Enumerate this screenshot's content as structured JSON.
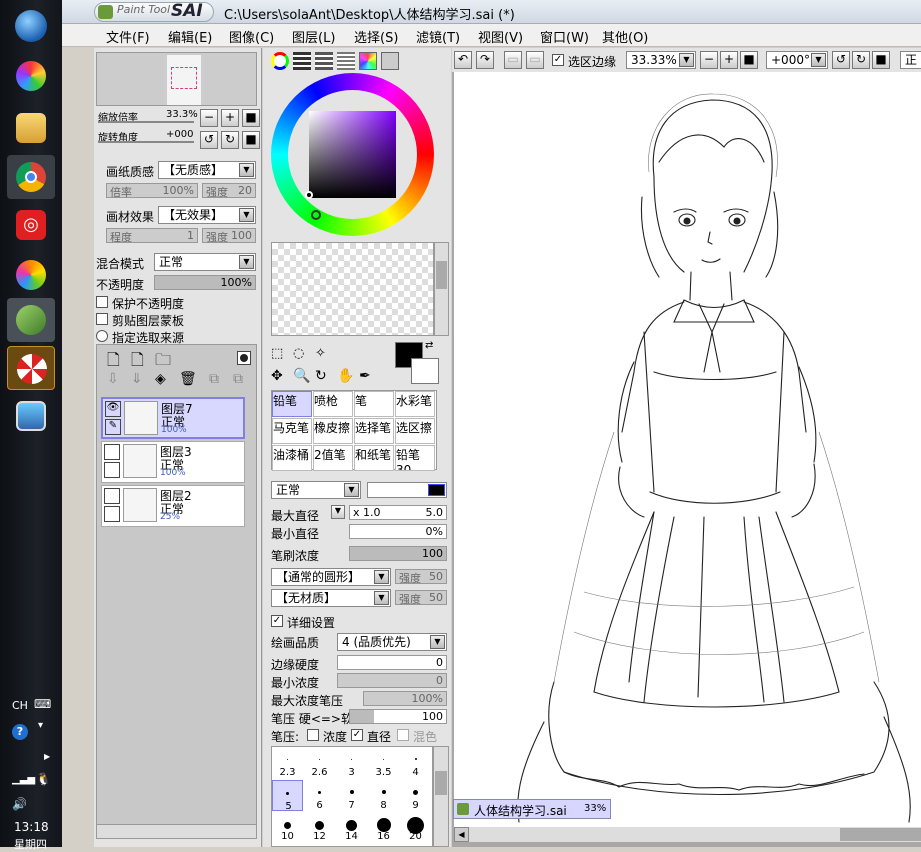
{
  "taskbar": {
    "apps": [
      "start-orb",
      "app-colorful",
      "file-explorer",
      "chrome",
      "netease-music",
      "app-ball",
      "paint-tool-sai",
      "app-umbrella",
      "app-picture"
    ],
    "tray": {
      "lang": "CH",
      "time": "13:18",
      "day": "星期四"
    }
  },
  "window": {
    "logo_text": "Paint Tool",
    "logo_brand": "SAI",
    "title": "C:\\Users\\solaAnt\\Desktop\\人体结构学习.sai (*)"
  },
  "menu": [
    "文件(F)",
    "编辑(E)",
    "图像(C)",
    "图层(L)",
    "选择(S)",
    "滤镜(T)",
    "视图(V)",
    "窗口(W)",
    "其他(O)"
  ],
  "navigator": {
    "zoom_label": "缩放倍率",
    "zoom_value": "33.3%",
    "rotate_label": "旋转角度",
    "rotate_value": "+000"
  },
  "layer_props": {
    "paper_label": "画纸质感",
    "paper_value": "【无质感】",
    "paper_rate": "倍率",
    "paper_rate_val": "100%",
    "paper_strength": "强度",
    "paper_strength_val": "20",
    "effect_label": "画材效果",
    "effect_value": "【无效果】",
    "effect_degree": "程度",
    "effect_degree_val": "1",
    "effect_strength": "强度",
    "effect_strength_val": "100",
    "blend_label": "混合模式",
    "blend_value": "正常",
    "opacity_label": "不透明度",
    "opacity_value": "100%",
    "protect_opacity": "保护不透明度",
    "clip_mask": "剪贴图层蒙板",
    "selection_source": "指定选取来源"
  },
  "layers": [
    {
      "name": "图层7",
      "mode": "正常",
      "opacity": "100%",
      "selected": true
    },
    {
      "name": "图层3",
      "mode": "正常",
      "opacity": "100%",
      "selected": false
    },
    {
      "name": "图层2",
      "mode": "正常",
      "opacity": "25%",
      "selected": false
    }
  ],
  "brushes": [
    [
      "铅笔",
      "喷枪",
      "笔",
      "水彩笔"
    ],
    [
      "马克笔",
      "橡皮擦",
      "选择笔",
      "选区擦"
    ],
    [
      "油漆桶",
      "2值笔",
      "和纸笔",
      "铅笔30"
    ]
  ],
  "brush_settings": {
    "mode": "正常",
    "max_size_label": "最大直径",
    "max_size_mult": "x 1.0",
    "max_size_val": "5.0",
    "min_size_label": "最小直径",
    "min_size_val": "0%",
    "density_label": "笔刷浓度",
    "density_val": "100",
    "shape": "【通常的圆形】",
    "shape_strength": "强度",
    "shape_strength_val": "50",
    "texture": "【无材质】",
    "texture_strength": "强度",
    "texture_strength_val": "50",
    "detail_label": "详细设置",
    "quality_label": "绘画品质",
    "quality_val": "4 (品质优先)",
    "edge_label": "边缘硬度",
    "edge_val": "0",
    "min_density_label": "最小浓度",
    "min_density_val": "0",
    "max_pressure_label": "最大浓度笔压",
    "max_pressure_val": "100%",
    "pressure_label": "笔压 硬<=>软",
    "pressure_val": "100",
    "pressure_opts_label": "笔压:",
    "opt_density": "浓度",
    "opt_size": "直径",
    "opt_blend": "混色"
  },
  "brush_sizes": [
    [
      "2.3",
      "2.6",
      "3",
      "3.5",
      "4"
    ],
    [
      "5",
      "6",
      "7",
      "8",
      "9"
    ],
    [
      "10",
      "12",
      "14",
      "16",
      "20"
    ]
  ],
  "canvas_toolbar": {
    "edge_label": "选区边缘",
    "zoom_val": "33.33%",
    "rotate_val": "+000°",
    "normal_btn": "正"
  },
  "tab": {
    "name": "人体结构学习.sai",
    "zoom": "33%"
  },
  "colors": {
    "accent": "#8080e0",
    "fg": "#000000",
    "bg": "#ffffff"
  }
}
